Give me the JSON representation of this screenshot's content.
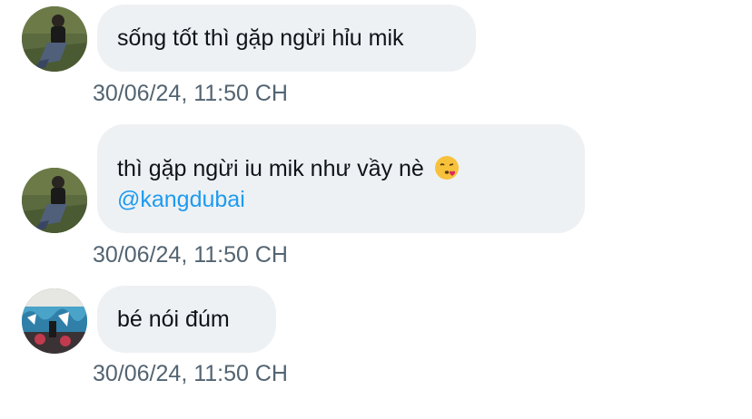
{
  "messages": [
    {
      "text": "sống tốt thì gặp ngừi hỉu mik",
      "timestamp": "30/06/24, 11:50 CH",
      "avatar": "person-sitting-on-grass-avatar"
    },
    {
      "text": "thì gặp ngừi iu mik như vầy nè",
      "emoji": "kissing-face-emoji",
      "mention": "@kangdubai",
      "timestamp": "30/06/24, 11:50 CH",
      "avatar": "person-sitting-on-grass-avatar"
    },
    {
      "text": "bé nói đúm",
      "timestamp": "30/06/24, 11:50 CH",
      "avatar": "graffiti-wall-avatar"
    }
  ],
  "colors": {
    "bubble_bg": "#eef1f4",
    "text": "#0f1419",
    "timestamp": "#536471",
    "mention": "#1d9bf0"
  }
}
